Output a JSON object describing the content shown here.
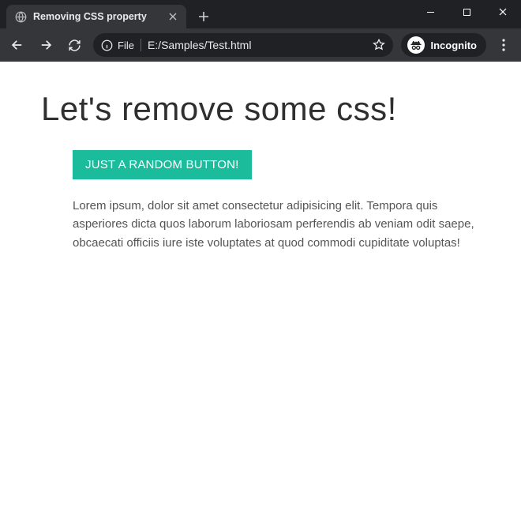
{
  "window": {
    "tab_title": "Removing CSS property",
    "incognito_label": "Incognito"
  },
  "omnibox": {
    "file_chip": "File",
    "url": "E:/Samples/Test.html"
  },
  "page": {
    "heading": "Let's remove some css!",
    "button_label": "JUST A RANDOM BUTTON!",
    "paragraph": "Lorem ipsum, dolor sit amet consectetur adipisicing elit. Tempora quis asperiores dicta quos laborum laboriosam perferendis ab veniam odit saepe, obcaecati officiis iure iste voluptates at quod commodi cupiditate voluptas!"
  },
  "colors": {
    "accent": "#1abc9c"
  }
}
